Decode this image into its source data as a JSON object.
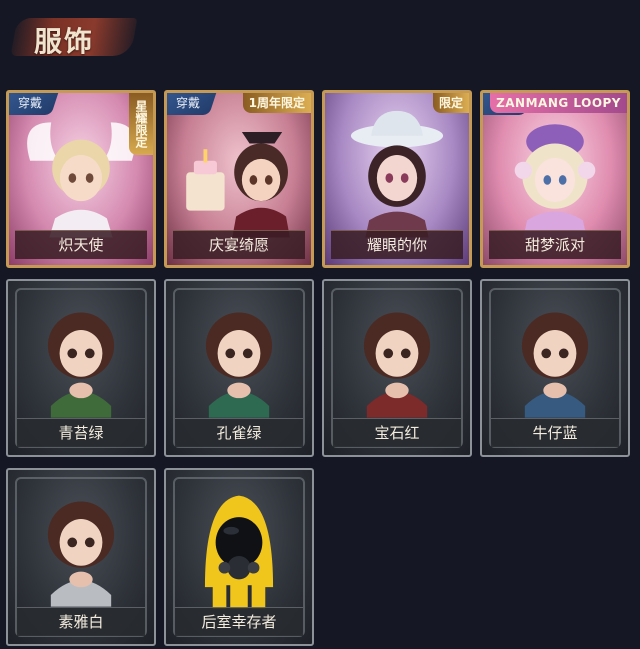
{
  "header": {
    "title": "服饰"
  },
  "badges": {
    "equipped": "穿戴"
  },
  "cards": [
    {
      "name": "炽天使",
      "tag": "星耀限定",
      "equipped": true,
      "style": "premium"
    },
    {
      "name": "庆宴绮愿",
      "tag": "1周年限定",
      "equipped": true,
      "style": "premium"
    },
    {
      "name": "耀眼的你",
      "tag": "限定",
      "equipped": false,
      "style": "premium"
    },
    {
      "name": "甜梦派对",
      "tag": "ZANMANG LOOPY",
      "equipped": true,
      "style": "premium"
    },
    {
      "name": "青苔绿",
      "style": "default",
      "accent": "#3f6b3b"
    },
    {
      "name": "孔雀绿",
      "style": "default",
      "accent": "#2e6a52"
    },
    {
      "name": "宝石红",
      "style": "default",
      "accent": "#7c2a2a"
    },
    {
      "name": "牛仔蓝",
      "style": "default",
      "accent": "#375a80"
    },
    {
      "name": "素雅白",
      "style": "default",
      "accent": "#b9bdc2"
    },
    {
      "name": "后室幸存者",
      "style": "default",
      "accent": "#f0c51c"
    }
  ]
}
